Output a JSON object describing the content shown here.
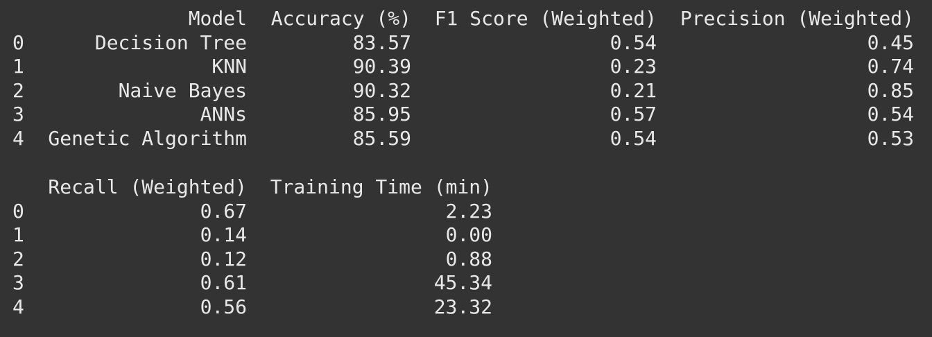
{
  "table1": {
    "headers": [
      "Model",
      "Accuracy (%)",
      "F1 Score (Weighted)",
      "Precision (Weighted)"
    ],
    "rows": [
      {
        "index": "0",
        "model": "Decision Tree",
        "accuracy": "83.57",
        "f1": "0.54",
        "precision": "0.45"
      },
      {
        "index": "1",
        "model": "KNN",
        "accuracy": "90.39",
        "f1": "0.23",
        "precision": "0.74"
      },
      {
        "index": "2",
        "model": "Naive Bayes",
        "accuracy": "90.32",
        "f1": "0.21",
        "precision": "0.85"
      },
      {
        "index": "3",
        "model": "ANNs",
        "accuracy": "85.95",
        "f1": "0.57",
        "precision": "0.54"
      },
      {
        "index": "4",
        "model": "Genetic Algorithm",
        "accuracy": "85.59",
        "f1": "0.54",
        "precision": "0.53"
      }
    ]
  },
  "table2": {
    "headers": [
      "Recall (Weighted)",
      "Training Time (min)"
    ],
    "rows": [
      {
        "index": "0",
        "recall": "0.67",
        "time": "2.23"
      },
      {
        "index": "1",
        "recall": "0.14",
        "time": "0.00"
      },
      {
        "index": "2",
        "recall": "0.12",
        "time": "0.88"
      },
      {
        "index": "3",
        "recall": "0.61",
        "time": "45.34"
      },
      {
        "index": "4",
        "recall": "0.56",
        "time": "23.32"
      }
    ]
  }
}
